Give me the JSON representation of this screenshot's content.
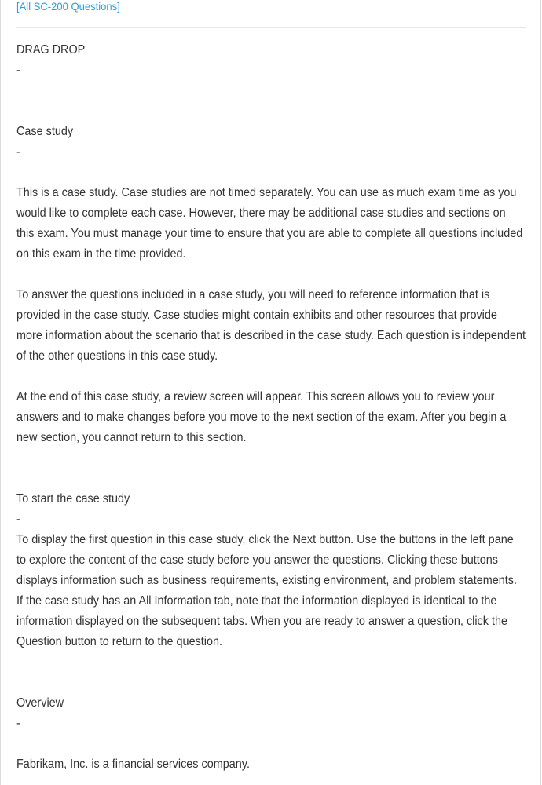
{
  "nav": {
    "back_link": "[All SC-200 Questions]"
  },
  "question": {
    "type_label": "DRAG DROP",
    "separator": "-",
    "case_study_heading": "Case study",
    "intro_paragraphs": [
      "This is a case study. Case studies are not timed separately. You can use as much exam time as you would like to complete each case. However, there may be additional case studies and sections on this exam. You must manage your time to ensure that you are able to complete all questions included on this exam in the time provided.",
      "To answer the questions included in a case study, you will need to reference information that is provided in the case study. Case studies might contain exhibits and other resources that provide more information about the scenario that is described in the case study. Each question is independent of the other questions in this case study.",
      "At the end of this case study, a review screen will appear. This screen allows you to review your answers and to make changes before you move to the next section of the exam. After you begin a new section, you cannot return to this section."
    ],
    "start_heading": "To start the case study",
    "start_paragraph": "To display the first question in this case study, click the Next button. Use the buttons in the left pane to explore the content of the case study before you answer the questions. Clicking these buttons displays information such as business requirements, existing environment, and problem statements. If the case study has an All Information tab, note that the information displayed is identical to the information displayed on the subsequent tabs. When you are ready to answer a question, click the Question button to return to the question.",
    "overview_heading": "Overview",
    "overview_paragraph": "Fabrikam, Inc. is a financial services company."
  },
  "colors": {
    "link": "#2a9fd8",
    "text": "#333333",
    "divider": "#e6e6e6",
    "frame": "#dcdcdc"
  }
}
